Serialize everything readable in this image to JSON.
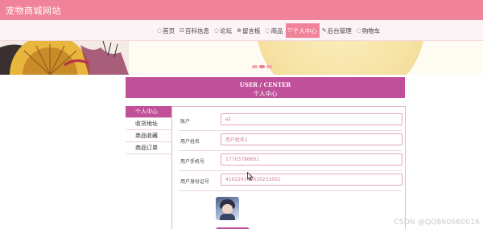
{
  "site": {
    "title": "宠物商城网站"
  },
  "nav": {
    "items": [
      {
        "icon": "home-icon",
        "glyph": "◌",
        "label": "首页"
      },
      {
        "icon": "encyclopedia-icon",
        "glyph": "⊡",
        "label": "百科信息"
      },
      {
        "icon": "forum-icon",
        "glyph": "◌",
        "label": "论坛"
      },
      {
        "icon": "message-board-icon",
        "glyph": "⊕",
        "label": "留言板"
      },
      {
        "icon": "products-icon",
        "glyph": "◌",
        "label": "商品"
      },
      {
        "icon": "user-center-icon",
        "glyph": "⛉",
        "label": "个人中心",
        "active": true
      },
      {
        "icon": "admin-icon",
        "glyph": "✎",
        "label": "后台管理"
      },
      {
        "icon": "cart-icon",
        "glyph": "◌",
        "label": "购物车"
      }
    ]
  },
  "banner": {
    "slide_count": 3,
    "active_slide": 2
  },
  "center": {
    "title_en": "USER / CENTER",
    "title_cn": "个人中心"
  },
  "side_menu": {
    "items": [
      {
        "label": "个人中心",
        "active": true
      },
      {
        "label": "收货地址"
      },
      {
        "label": "商品收藏"
      },
      {
        "label": "商品订单"
      }
    ]
  },
  "form": {
    "account": {
      "label": "账户",
      "value": "a1"
    },
    "username": {
      "label": "用户姓名",
      "value": "用户姓名1"
    },
    "phone": {
      "label": "用户手机号",
      "value": "17703786601"
    },
    "id_card": {
      "label": "用户身份证号",
      "value": "410224199610232001"
    }
  },
  "watermark": {
    "text": "CSDN @QQ860660016"
  },
  "colors": {
    "accent": "#f0839a",
    "primary": "#c0509a"
  }
}
